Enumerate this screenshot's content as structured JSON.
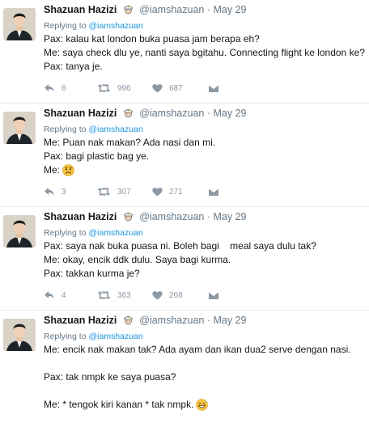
{
  "tweets": [
    {
      "author_name": "Shazuan Hazizi",
      "handle": "@iamshazuan",
      "separator": "·",
      "date": "May 29",
      "replying_prefix": "Replying to",
      "replying_handle": "@iamshazuan",
      "lines": [
        "Pax: kalau kat london buka puasa jam berapa eh?",
        "Me: saya check dlu ye, nanti saya bgitahu. Connecting flight ke london ke?",
        "Pax: tanya je."
      ],
      "counts": {
        "replies": "6",
        "retweets": "996",
        "likes": "687"
      }
    },
    {
      "author_name": "Shazuan Hazizi",
      "handle": "@iamshazuan",
      "separator": "·",
      "date": "May 29",
      "replying_prefix": "Replying to",
      "replying_handle": "@iamshazuan",
      "lines": [
        "Me: Puan nak makan? Ada nasi dan mi.",
        "Pax: bagi plastic bag ye.",
        "Me:"
      ],
      "emoji": "disappointed-face-emoji",
      "counts": {
        "replies": "3",
        "retweets": "307",
        "likes": "271"
      }
    },
    {
      "author_name": "Shazuan Hazizi",
      "handle": "@iamshazuan",
      "separator": "·",
      "date": "May 29",
      "replying_prefix": "Replying to",
      "replying_handle": "@iamshazuan",
      "lines": [
        "Pax: saya nak buka puasa ni. Boleh bagi    meal saya dulu tak?",
        "Me: okay, encik ddk dulu. Saya bagi kurma.",
        "Pax: takkan kurma je?"
      ],
      "counts": {
        "replies": "4",
        "retweets": "363",
        "likes": "268"
      }
    },
    {
      "author_name": "Shazuan Hazizi",
      "handle": "@iamshazuan",
      "separator": "·",
      "date": "May 29",
      "replying_prefix": "Replying to",
      "replying_handle": "@iamshazuan",
      "lines": [
        "Me: encik nak makan tak? Ada ayam dan ikan dua2 serve dengan nasi.",
        "",
        "Pax: tak nmpk ke saya puasa?",
        "",
        "Me: * tengok kiri kanan * tak nmpk."
      ],
      "emoji": "grinning-sweat-emoji",
      "counts": {
        "replies": "",
        "retweets": "",
        "likes": ""
      }
    }
  ],
  "colors": {
    "text": "#14171a",
    "secondary": "#657786",
    "link": "#1b95e0",
    "icon": "#8b98a5",
    "divider": "#e6ecf0"
  },
  "icons": [
    "reply-icon",
    "retweet-icon",
    "like-heart-icon",
    "direct-message-icon",
    "pilot-cap-badge-icon"
  ]
}
